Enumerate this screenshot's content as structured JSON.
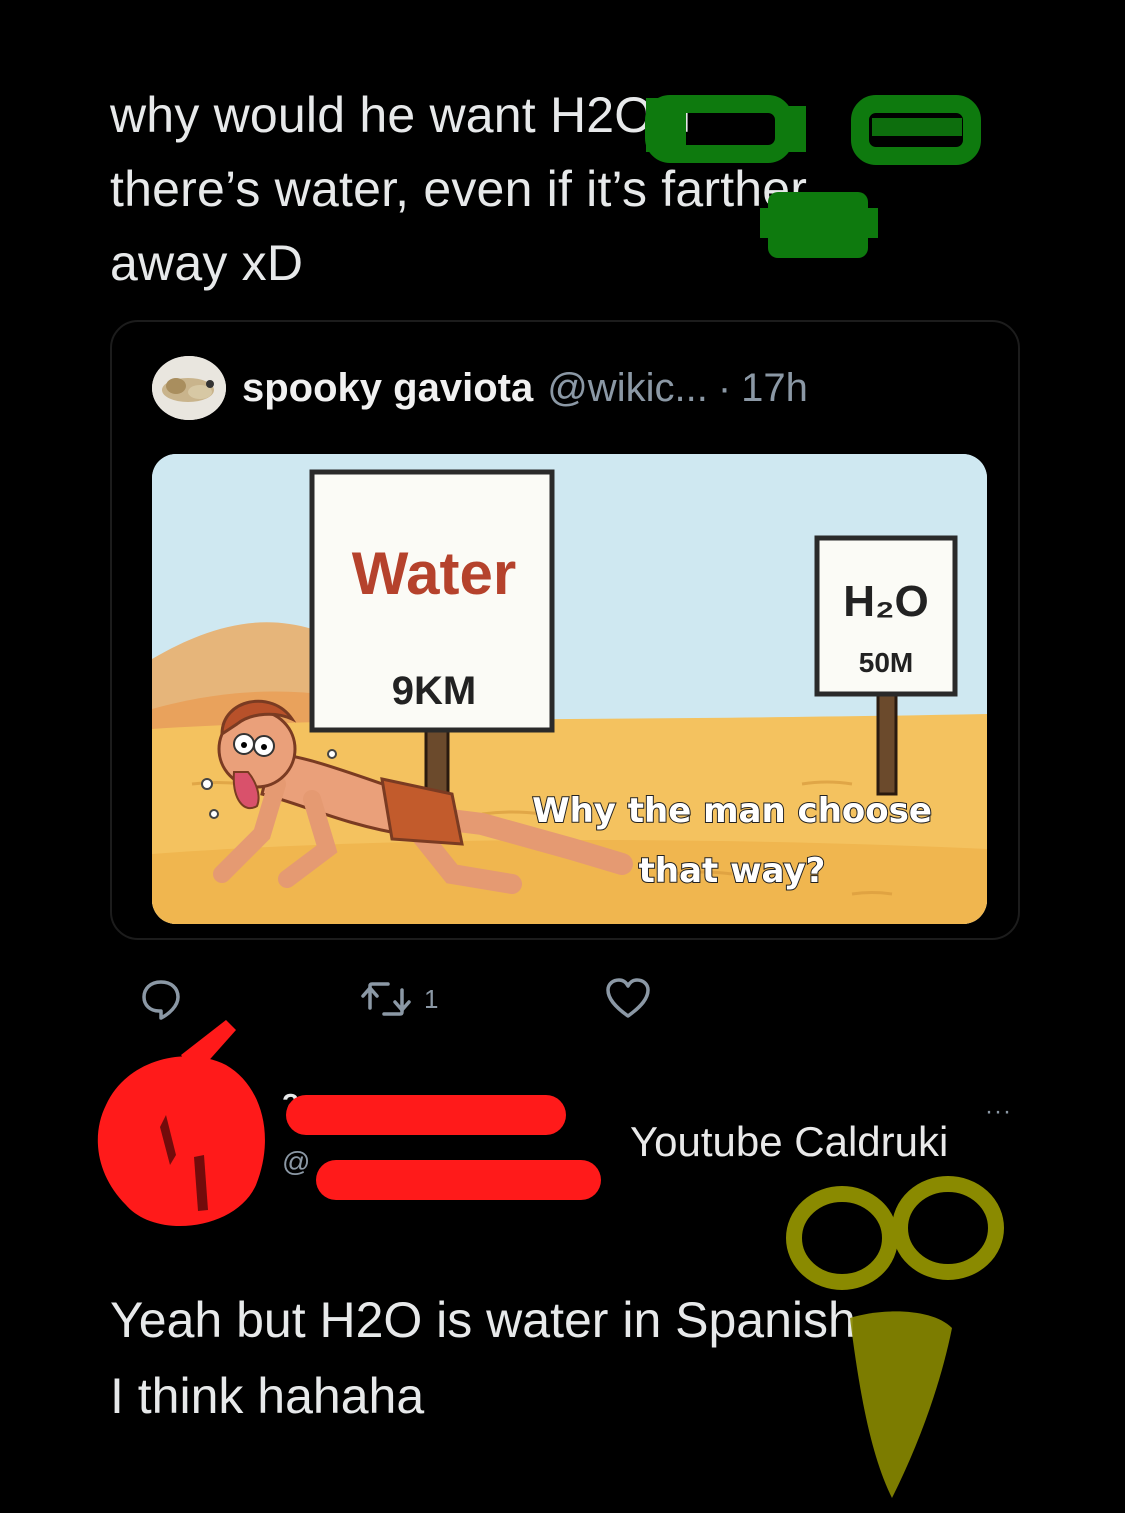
{
  "tweet": {
    "text_line1": "why would he want H2O if",
    "text_line2": "there’s water, even if it’s farther",
    "text_line3": "away xD"
  },
  "quote": {
    "author_name": "spooky gaviota",
    "author_handle": "@wikic...",
    "separator": "·",
    "time": "17h",
    "meme": {
      "sign_left_title": "Water",
      "sign_left_distance": "9KM",
      "sign_right_title": "H₂O",
      "sign_right_distance": "50M",
      "caption_line1": "Why the man choose",
      "caption_line2": "that way?"
    }
  },
  "actions": {
    "retweet_count": "1"
  },
  "reply": {
    "name_partial": "?",
    "handle_partial": "@",
    "more_icon": "···",
    "watermark": "Youtube Caldruki",
    "text_line1": "Yeah but H2O is water in Spanish",
    "text_line2": "I think hahaha"
  },
  "colors": {
    "background": "#000000",
    "text": "#e7e9ea",
    "muted": "#8b98a5",
    "scribble_green": "#0e7a0e",
    "scribble_red": "#ff1a1a",
    "scribble_yellow": "#8a8a00"
  }
}
